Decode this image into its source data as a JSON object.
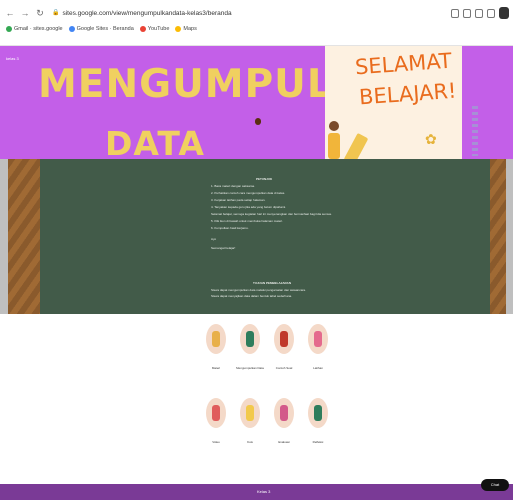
{
  "browser": {
    "back_icon": "arrow-left-icon",
    "forward_icon": "arrow-right-icon",
    "reload_icon": "reload-icon",
    "url": "sites.google.com/view/mengumpulkandata-kelas3/beranda"
  },
  "bookmarks": [
    {
      "label": "Gmail · sites.google",
      "color": "#34a853"
    },
    {
      "label": "Google Sites · Beranda",
      "color": "#4285f4"
    },
    {
      "label": "YouTube",
      "color": "#ea4335"
    },
    {
      "label": "Maps",
      "color": "#fbbc05"
    }
  ],
  "hero": {
    "site_logo": "kelas 3",
    "title_line1": "MENGUMPULKAN",
    "title_line2": "DATA",
    "greeting_line1": "SELAMAT",
    "greeting_line2": "BELAJAR!"
  },
  "board": {
    "heading": "PETUNJUK",
    "lines": [
      "1. Baca materi dengan saksama.",
      "2. Perhatikan contoh cara mengumpulkan data di kelas.",
      "3. Kerjakan latihan pada setiap halaman.",
      "4. Tanyakan kepada guru jika ada yang belum dipahami.",
      "Selamat belajar, semoga kegiatan hari ini menyenangkan dan bermanfaat bagi kita semua.",
      "5. Klik ikon di bawah untuk membuka halaman materi.",
      "6. Kumpulkan hasil kerjamu.",
      "Ayo",
      "Semangat belajar!"
    ],
    "subheading": "TUJUAN PEMBELAJARAN",
    "sub_lines": [
      "Siswa dapat mengumpulkan data melalui pengamatan dan wawancara.",
      "Siswa dapat menyajikan data dalam bentuk tabel sederhana."
    ]
  },
  "menu_top": [
    {
      "label": "Materi",
      "figure_color": "#e8b04a"
    },
    {
      "label": "Mengumpulkan Data",
      "figure_color": "#2f7d5c"
    },
    {
      "label": "Contoh Soal",
      "figure_color": "#c0392b"
    },
    {
      "label": "Latihan",
      "figure_color": "#e46a8d"
    }
  ],
  "menu_bottom": [
    {
      "label": "Video",
      "figure_color": "#e05c5c"
    },
    {
      "label": "Kuis",
      "figure_color": "#f2c94c"
    },
    {
      "label": "Evaluasi",
      "figure_color": "#d35a8a"
    },
    {
      "label": "Refleksi",
      "figure_color": "#2f7d5c"
    }
  ],
  "footer": {
    "text": "Kelas 3",
    "chat_label": "Chat"
  },
  "colors": {
    "hero_purple": "#c35fe8",
    "title_yellow": "#f0d060",
    "board_green": "#425b49",
    "footer_purple": "#7a3a96"
  }
}
